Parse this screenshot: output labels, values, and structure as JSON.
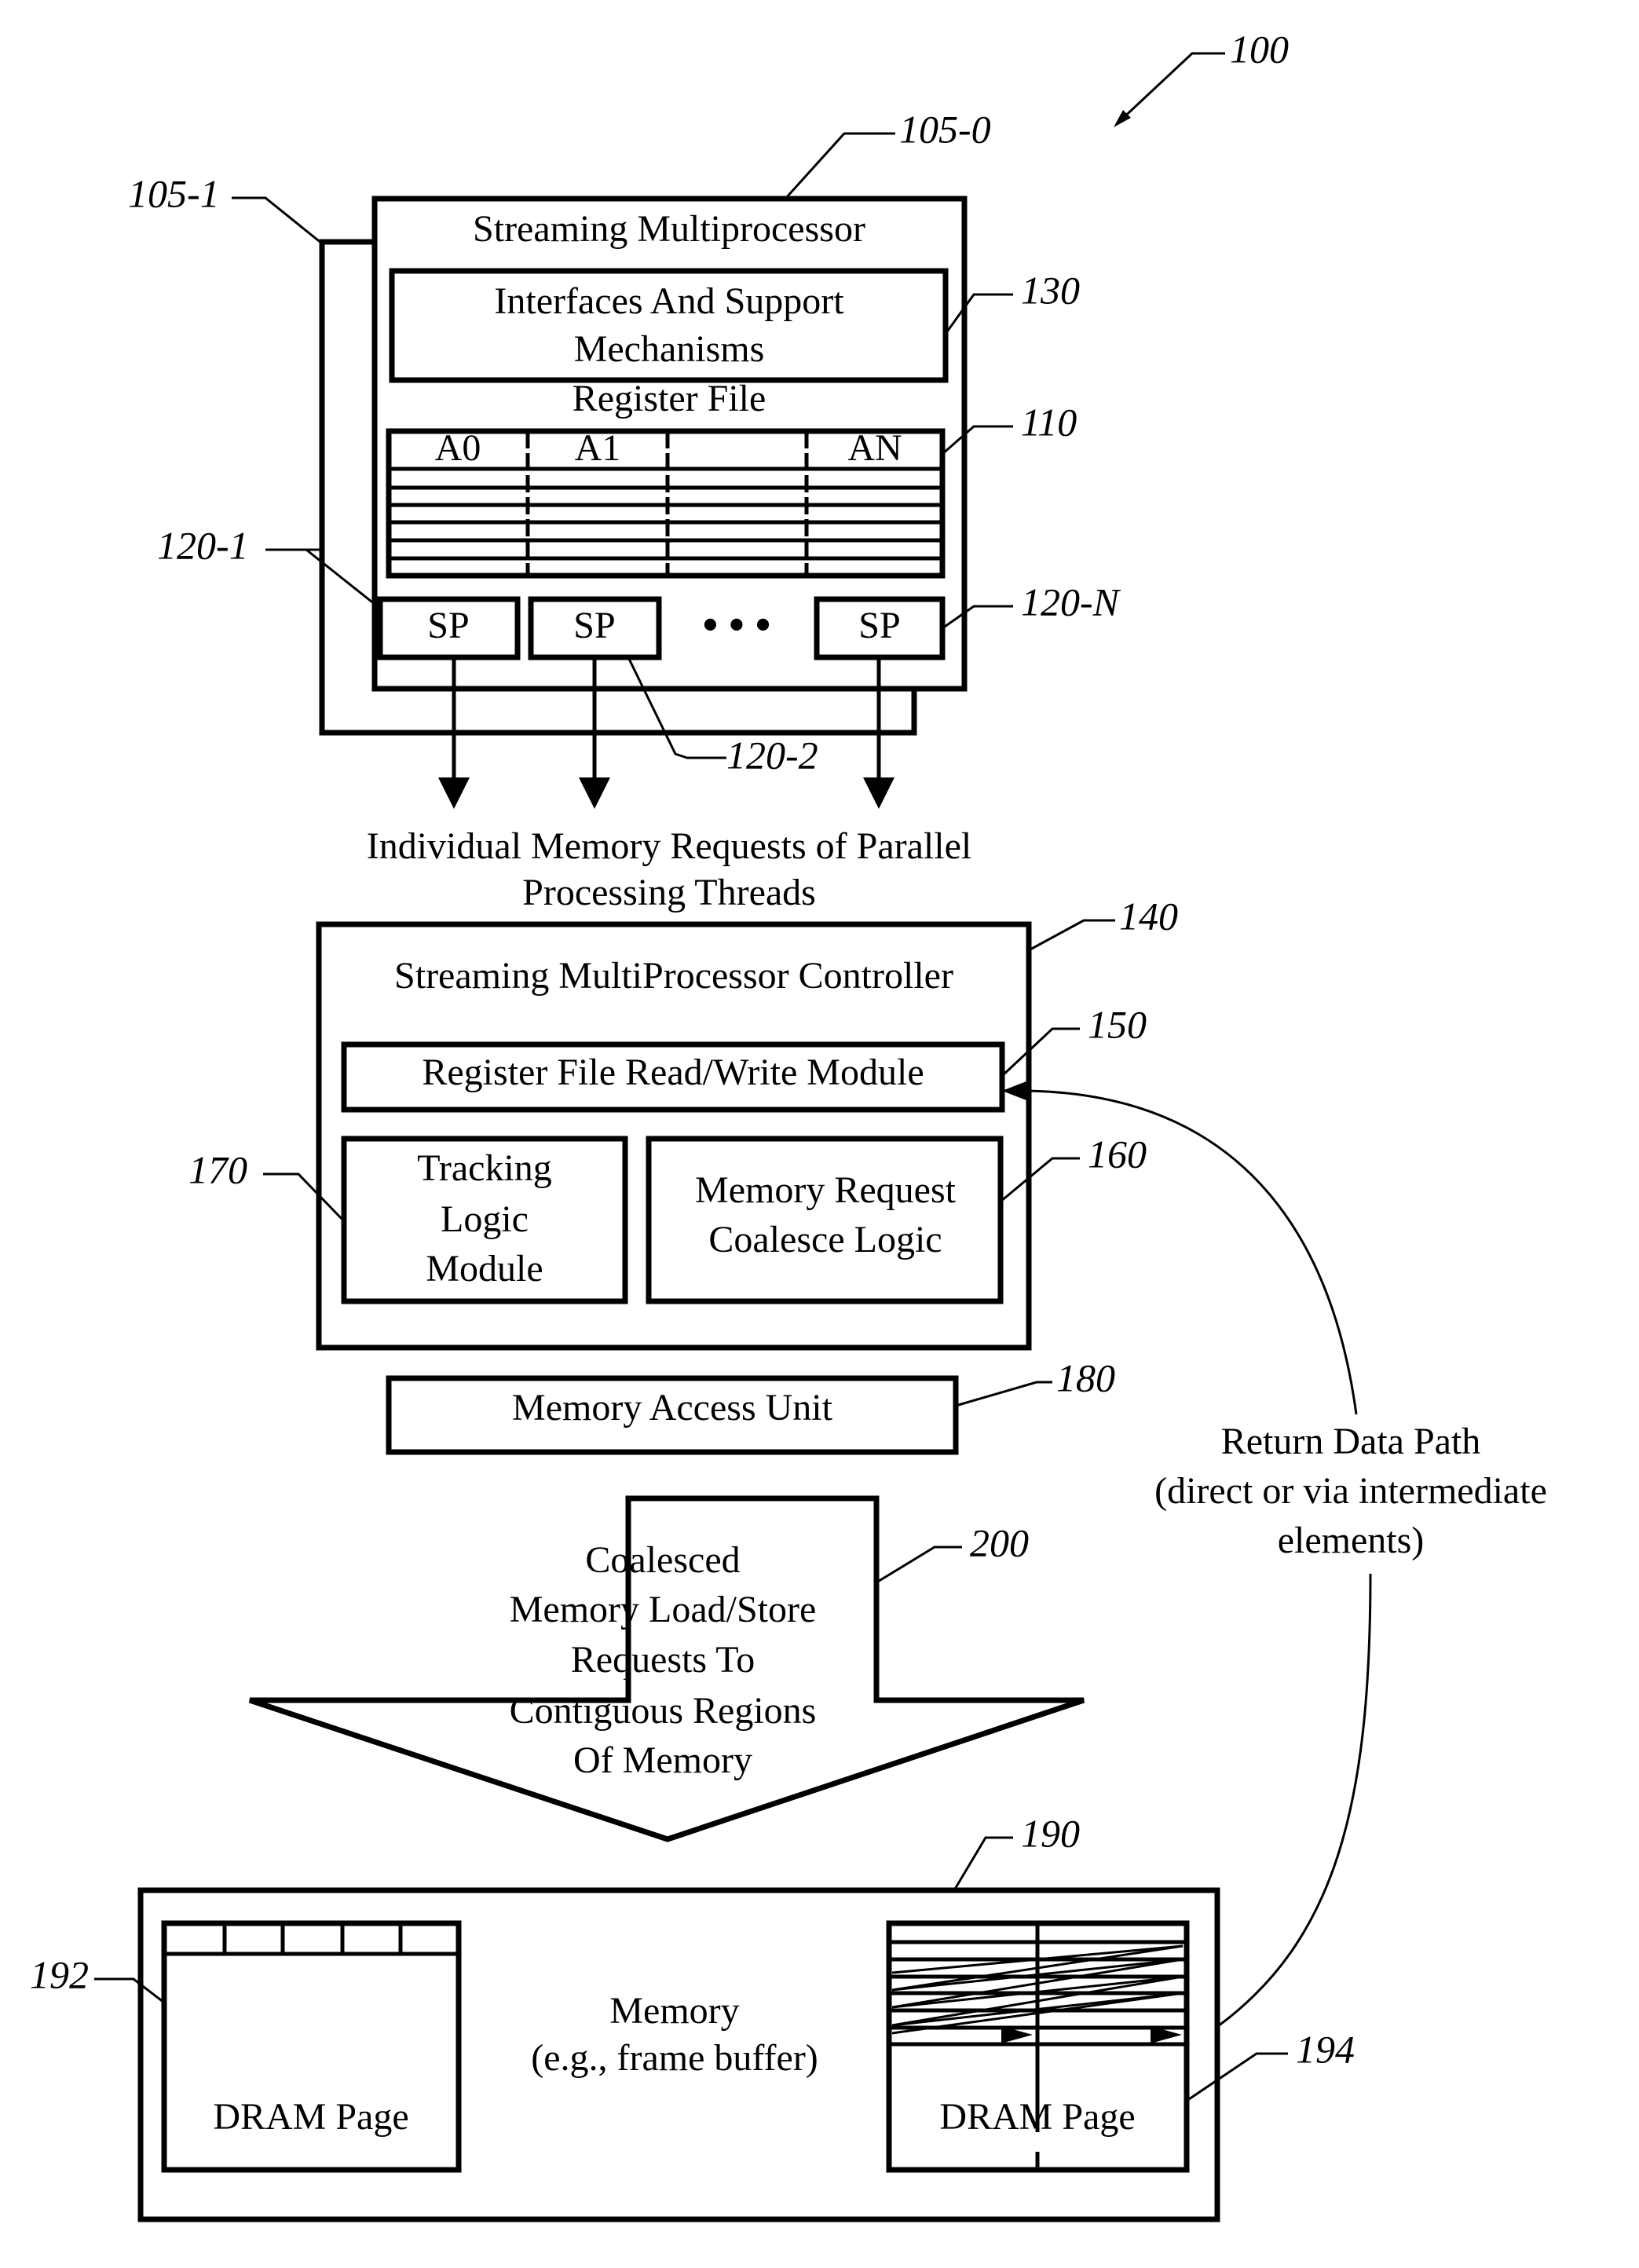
{
  "figure_ref": "100",
  "sm": {
    "front_ref": "105-0",
    "back_ref": "105-1",
    "title": "Streaming Multiprocessor",
    "interfaces": {
      "ref": "130",
      "line1": "Interfaces And Support",
      "line2": "Mechanisms"
    },
    "register_file": {
      "title": "Register File",
      "ref": "110",
      "columns": [
        "A0",
        "A1",
        "",
        "AN"
      ]
    },
    "processors": {
      "label": "SP",
      "ellipsis": "• • •",
      "refs": [
        "120-1",
        "120-2",
        "120-N"
      ]
    }
  },
  "requests_caption": {
    "line1": "Individual Memory Requests of Parallel",
    "line2": "Processing Threads"
  },
  "controller": {
    "ref": "140",
    "title": "Streaming MultiProcessor Controller",
    "rw_module": {
      "ref": "150",
      "label": "Register File Read/Write Module"
    },
    "tracking": {
      "ref": "170",
      "lines": [
        "Tracking",
        "Logic",
        "Module"
      ]
    },
    "coalesce": {
      "ref": "160",
      "lines": [
        "Memory Request",
        "Coalesce Logic"
      ]
    }
  },
  "memory_access_unit": {
    "ref": "180",
    "label": "Memory Access Unit"
  },
  "coalesced_arrow": {
    "ref": "200",
    "lines": [
      "Coalesced",
      "Memory Load/Store",
      "Requests To",
      "Contiguous Regions",
      "Of Memory"
    ]
  },
  "return_path": {
    "lines": [
      "Return Data Path",
      "(direct or via intermediate",
      "elements)"
    ]
  },
  "memory": {
    "ref": "190",
    "lines": [
      "Memory",
      "(e.g., frame buffer)"
    ],
    "left_page": {
      "ref": "192",
      "label": "DRAM Page"
    },
    "right_page": {
      "ref": "194",
      "label": "DRAM Page"
    }
  }
}
